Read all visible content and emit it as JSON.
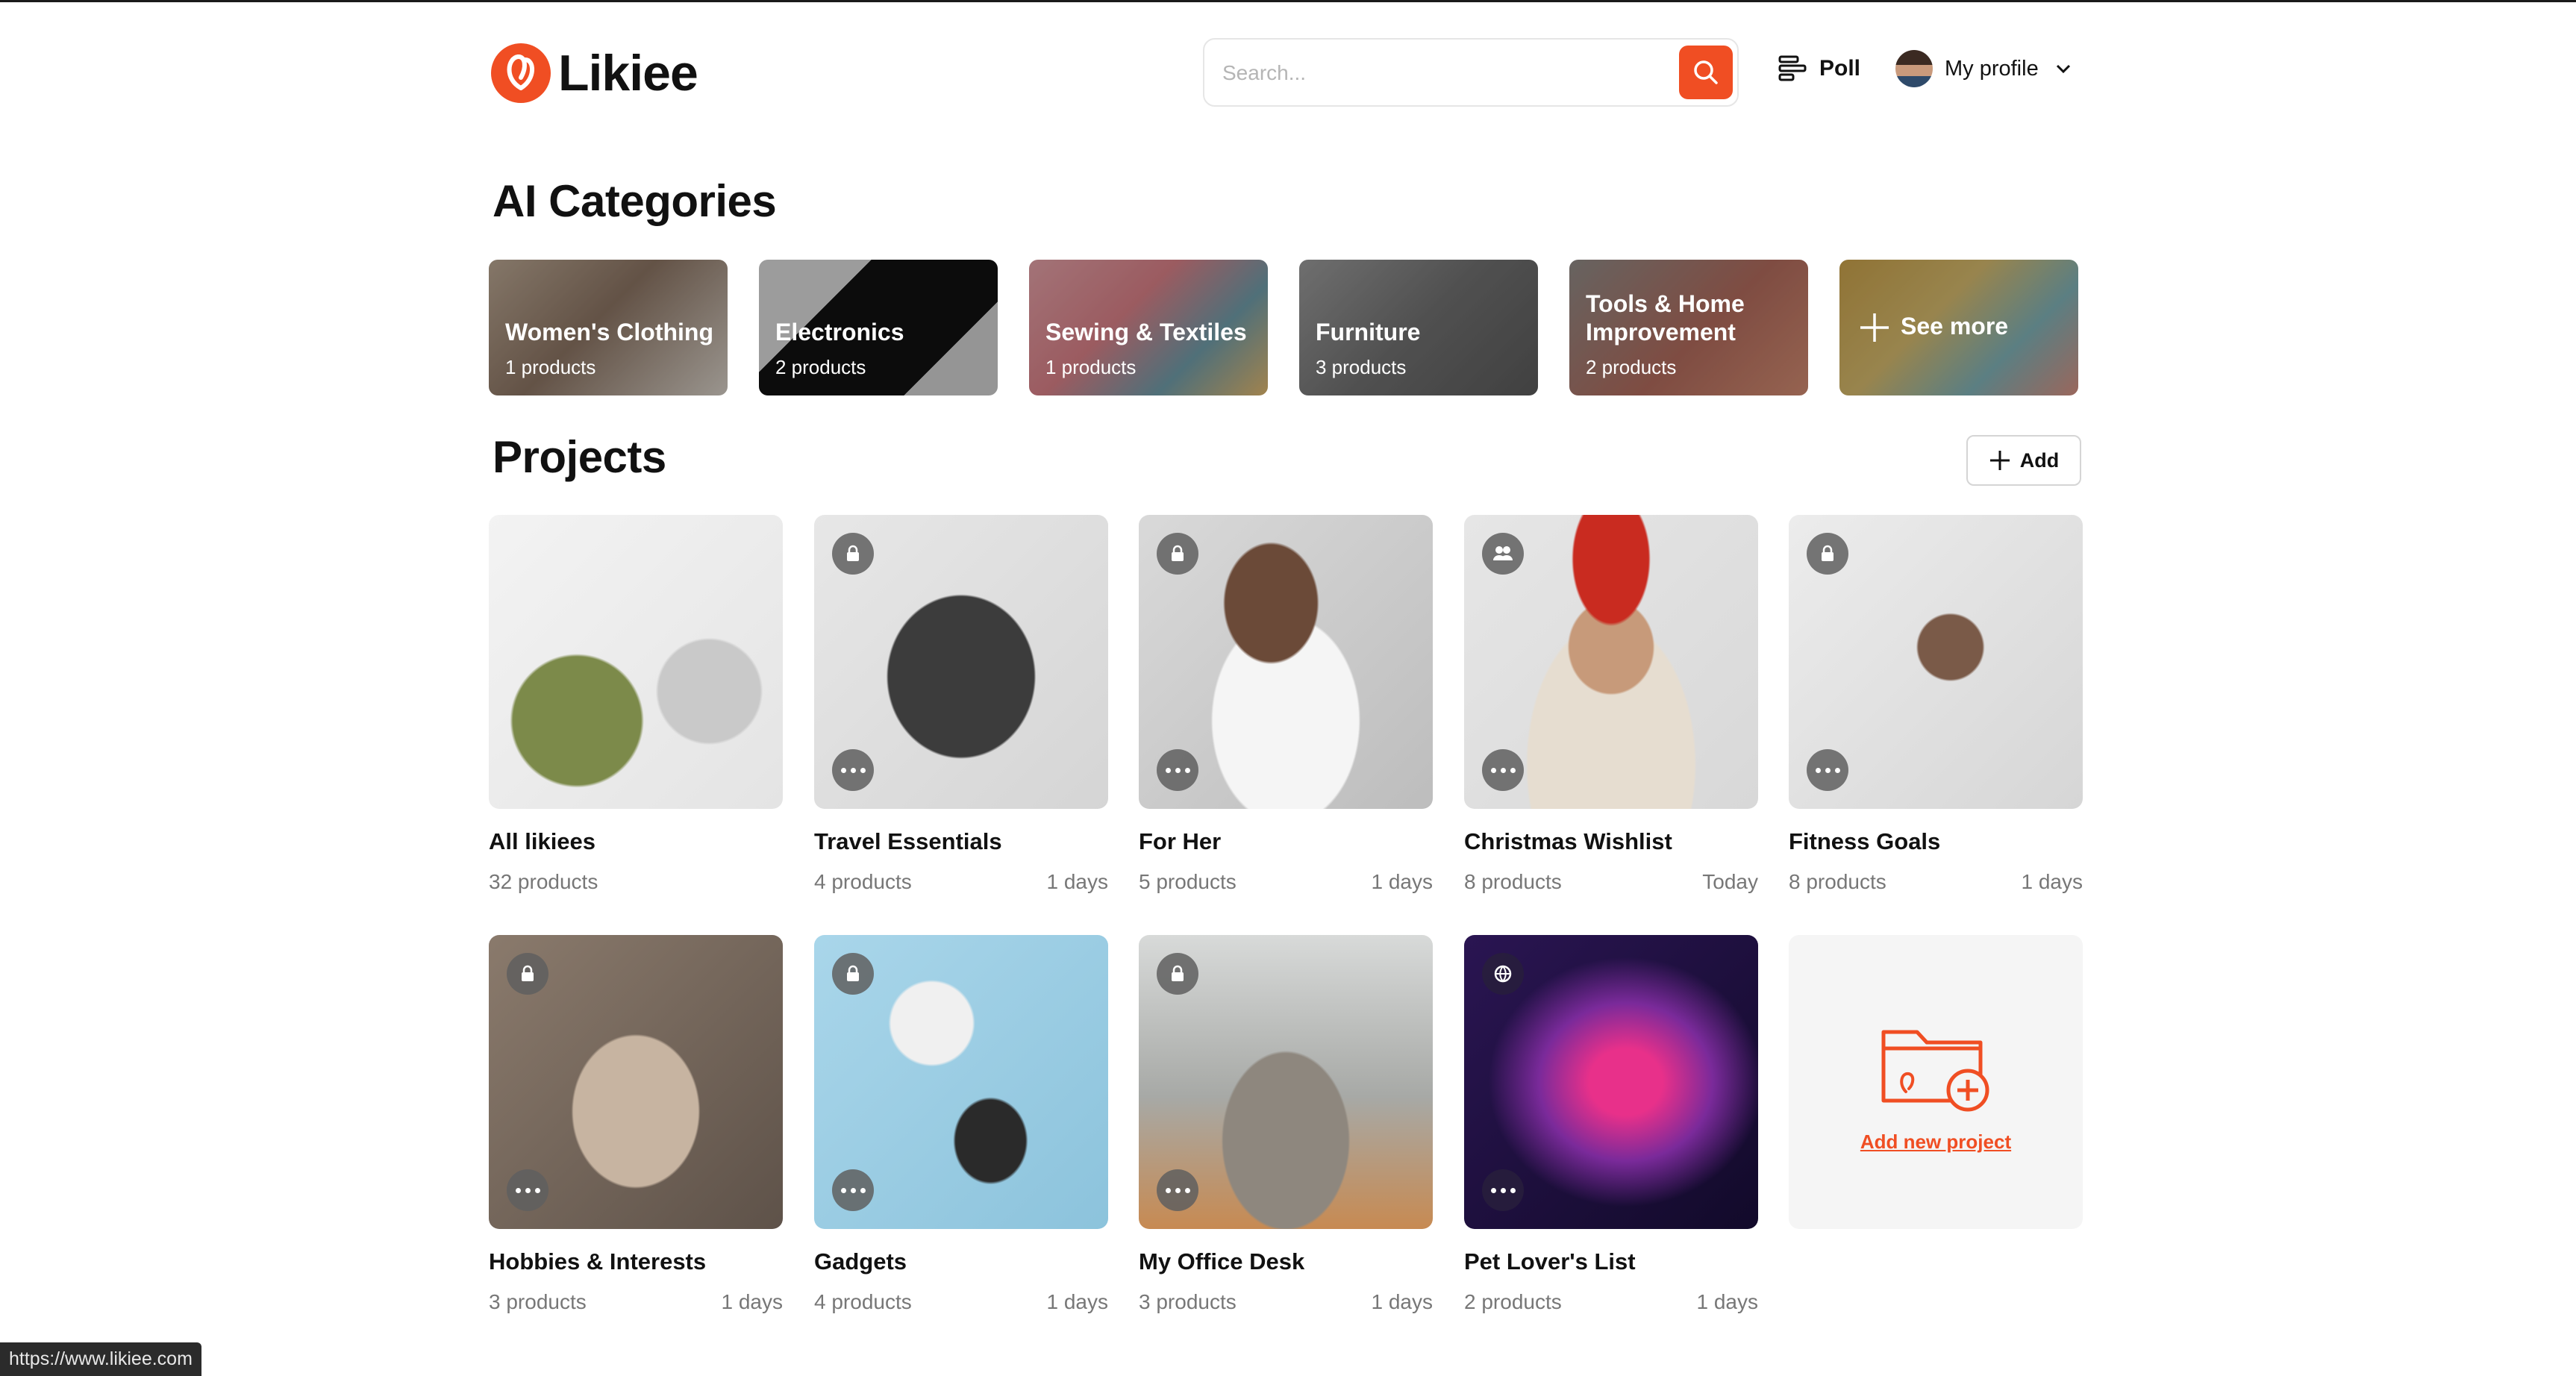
{
  "header": {
    "logo_text": "Likiee",
    "search_placeholder": "Search...",
    "poll_label": "Poll",
    "profile_label": "My profile"
  },
  "categories_title": "AI Categories",
  "categories": [
    {
      "name": "Women's Clothing",
      "count": "1 products"
    },
    {
      "name": "Electronics",
      "count": "2 products"
    },
    {
      "name": "Sewing & Textiles",
      "count": "1 products"
    },
    {
      "name": "Furniture",
      "count": "3 products"
    },
    {
      "name": "Tools & Home Improvement",
      "count": "2 products"
    }
  ],
  "see_more_label": "See more",
  "projects_title": "Projects",
  "add_label": "Add",
  "projects": [
    {
      "title": "All likiees",
      "count": "32 products",
      "age": "",
      "badge": "none"
    },
    {
      "title": "Travel Essentials",
      "count": "4 products",
      "age": "1 days",
      "badge": "lock-icon"
    },
    {
      "title": "For Her",
      "count": "5 products",
      "age": "1 days",
      "badge": "lock-icon"
    },
    {
      "title": "Christmas Wishlist",
      "count": "8 products",
      "age": "Today",
      "badge": "people-icon"
    },
    {
      "title": "Fitness Goals",
      "count": "8 products",
      "age": "1 days",
      "badge": "lock-icon"
    },
    {
      "title": "Hobbies & Interests",
      "count": "3 products",
      "age": "1 days",
      "badge": "lock-icon"
    },
    {
      "title": "Gadgets",
      "count": "4 products",
      "age": "1 days",
      "badge": "lock-icon"
    },
    {
      "title": "My Office Desk",
      "count": "3 products",
      "age": "1 days",
      "badge": "lock-icon"
    },
    {
      "title": "Pet Lover's List",
      "count": "2 products",
      "age": "1 days",
      "badge": "globe-icon"
    }
  ],
  "add_new_project_label": "Add new project",
  "status_url": "https://www.likiee.com",
  "colors": {
    "accent": "#f04e23",
    "text": "#111111",
    "muted": "#777777"
  }
}
